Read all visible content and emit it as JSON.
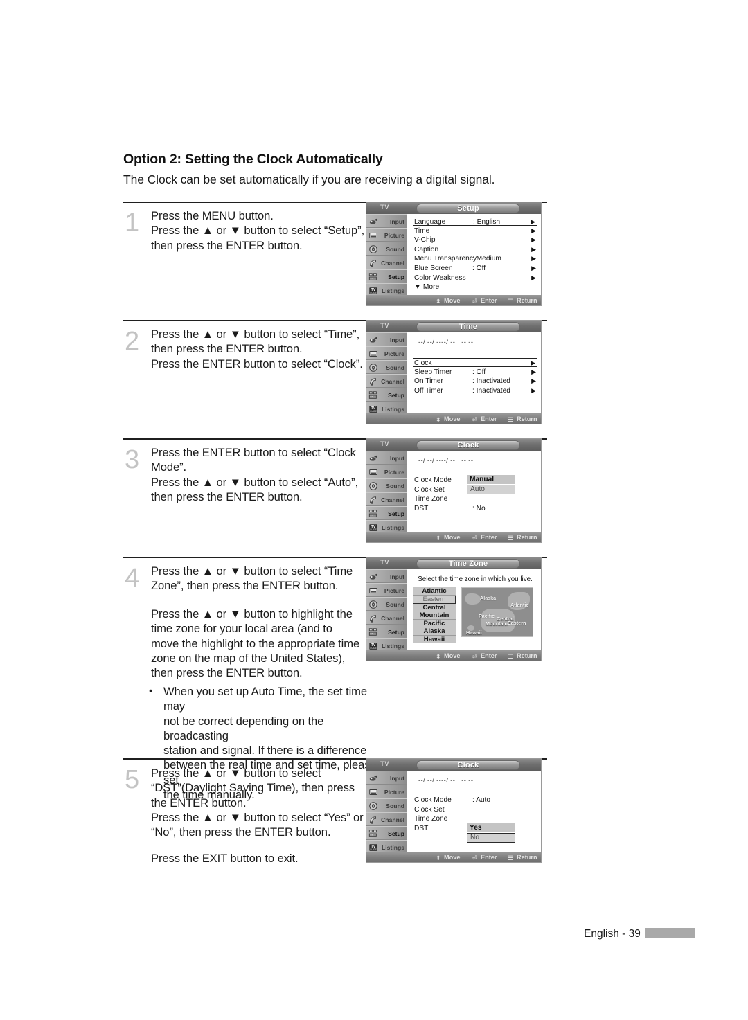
{
  "page": {
    "title": "Option 2: Setting the Clock Automatically",
    "subtitle": "The Clock can be set automatically if you are receiving a digital signal.",
    "footer_text": "English - 39"
  },
  "steps": [
    {
      "number": "1",
      "text": "Press the MENU button.\nPress the ▲ or ▼ button to select “Setup”,\nthen press the ENTER button."
    },
    {
      "number": "2",
      "text": "Press the ▲ or ▼ button to select “Time”,\nthen press the ENTER button.\nPress the ENTER button to select “Clock”."
    },
    {
      "number": "3",
      "text": "Press the ENTER button to select “Clock\nMode”.\nPress the ▲ or ▼ button to select “Auto”,\nthen press the ENTER button."
    },
    {
      "number": "4",
      "text": "Press the ▲ or ▼ button to select “Time\nZone”, then press the ENTER button.",
      "text2": "Press the ▲ or ▼ button to highlight the\ntime zone for your local area (and to\nmove the highlight to the appropriate time\nzone on the map of the United States),\nthen press the ENTER button."
    },
    {
      "number": "5",
      "text": "Press the ▲ or ▼ button to select\n“DST”(Daylight Saving Time), then press\nthe ENTER button.\nPress the ▲ or ▼ button to select “Yes” or\n“No”, then press the ENTER button.",
      "text2": "Press the EXIT button to exit."
    }
  ],
  "note": {
    "bullet": "•",
    "text": "When you set up Auto Time, the set time may\nnot be correct depending on the broadcasting\nstation and signal. If there is a difference\nbetween the real time and set time, please set\nthe time manually."
  },
  "tv_common": {
    "tv_label": "TV",
    "sidebar": [
      {
        "label": "Input",
        "icon": "input-icon"
      },
      {
        "label": "Picture",
        "icon": "picture-icon"
      },
      {
        "label": "Sound",
        "icon": "sound-icon"
      },
      {
        "label": "Channel",
        "icon": "channel-icon"
      },
      {
        "label": "Setup",
        "icon": "setup-icon"
      },
      {
        "label": "Listings",
        "icon": "listings-icon"
      }
    ],
    "active_sidebar": "Setup",
    "footer_move": "Move",
    "footer_enter": "Enter",
    "footer_return": "Return",
    "clock_placeholder": "--/ --/ ----/ -- : -- --",
    "arrow": "▶",
    "move_icon": "⬍",
    "enter_icon": "⏎",
    "return_icon": "☰"
  },
  "menus": {
    "setup": {
      "title": "Setup",
      "rows": [
        {
          "label": "Language",
          "value": ": English",
          "arrow": true,
          "selected": true
        },
        {
          "label": "Time",
          "value": "",
          "arrow": true,
          "selected": false
        },
        {
          "label": "V-Chip",
          "value": "",
          "arrow": true,
          "selected": false
        },
        {
          "label": "Caption",
          "value": "",
          "arrow": true,
          "selected": false
        },
        {
          "label": "Menu Transparency",
          "value": ": Medium",
          "arrow": true,
          "selected": false
        },
        {
          "label": "Blue Screen",
          "value": ": Off",
          "arrow": true,
          "selected": false
        },
        {
          "label": "Color Weakness",
          "value": "",
          "arrow": true,
          "selected": false
        },
        {
          "label": "▼ More",
          "value": "",
          "arrow": false,
          "selected": false
        }
      ]
    },
    "time": {
      "title": "Time",
      "rows": [
        {
          "label": "Clock",
          "value": "",
          "arrow": true,
          "selected": true
        },
        {
          "label": "Sleep Timer",
          "value": ": Off",
          "arrow": true,
          "selected": false
        },
        {
          "label": "On Timer",
          "value": ": Inactivated",
          "arrow": true,
          "selected": false
        },
        {
          "label": "Off Timer",
          "value": ": Inactivated",
          "arrow": true,
          "selected": false
        }
      ]
    },
    "clock_mode": {
      "title": "Clock",
      "rows": [
        {
          "label": "Clock Mode"
        },
        {
          "label": "Clock Set"
        },
        {
          "label": "Time Zone"
        },
        {
          "label": "DST",
          "value": ": No"
        }
      ],
      "options": [
        {
          "text": "Manual",
          "selected": false
        },
        {
          "text": "Auto",
          "selected": true
        }
      ]
    },
    "time_zone": {
      "title": "Time Zone",
      "prompt": "Select the time zone in which you live.",
      "zones": [
        {
          "name": "Atlantic",
          "selected": false
        },
        {
          "name": "Eastern",
          "selected": true
        },
        {
          "name": "Central",
          "selected": false
        },
        {
          "name": "Mountain",
          "selected": false
        },
        {
          "name": "Pacific",
          "selected": false
        },
        {
          "name": "Alaska",
          "selected": false
        },
        {
          "name": "Hawaii",
          "selected": false
        }
      ],
      "map_labels": [
        "Alaska",
        "Atlantic",
        "Pacific",
        "Central",
        "Mountain",
        "Eastern",
        "Hawaii"
      ]
    },
    "clock_dst": {
      "title": "Clock",
      "rows": [
        {
          "label": "Clock Mode",
          "value": ": Auto"
        },
        {
          "label": "Clock Set"
        },
        {
          "label": "Time Zone"
        },
        {
          "label": "DST"
        }
      ],
      "options": [
        {
          "text": "Yes",
          "selected": false
        },
        {
          "text": "No",
          "selected": true
        }
      ]
    }
  }
}
